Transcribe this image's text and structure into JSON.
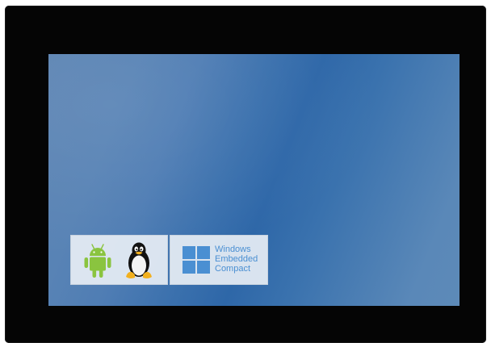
{
  "colors": {
    "bezel": "#050505",
    "screen": "#3a70ad",
    "badge_background": "#e6edf4",
    "android_green": "#8ac43f",
    "windows_blue": "#4a8fd2"
  },
  "icons": {
    "android": "android-icon",
    "linux": "linux-tux-icon",
    "windows": "windows-logo-icon"
  },
  "badges": {
    "windows": {
      "line1": "Windows",
      "line2": "Embedded",
      "line3": "Compact"
    }
  }
}
